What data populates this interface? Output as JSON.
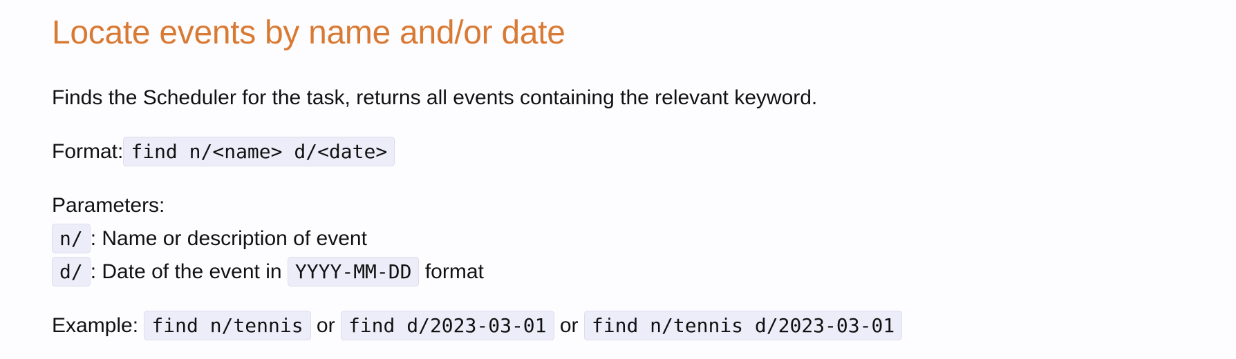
{
  "heading": "Locate events by name and/or date",
  "description": "Finds the Scheduler for the task, returns all events containing the relevant keyword.",
  "format": {
    "label": "Format:",
    "command": "find n/<name> d/<date>"
  },
  "parameters": {
    "label": "Parameters:",
    "items": [
      {
        "prefix": "n/",
        "text": ": Name or description of event"
      },
      {
        "prefix": "d/",
        "text_before": ": Date of the event in ",
        "code": "YYYY-MM-DD",
        "text_after": " format"
      }
    ]
  },
  "example": {
    "label": "Example:",
    "commands": [
      "find n/tennis",
      "find d/2023-03-01",
      "find n/tennis d/2023-03-01"
    ],
    "separator": "or"
  },
  "colors": {
    "heading": "#d97a34",
    "code_background": "#ededfa",
    "text": "#111111",
    "page_background": "#fdfdff"
  }
}
